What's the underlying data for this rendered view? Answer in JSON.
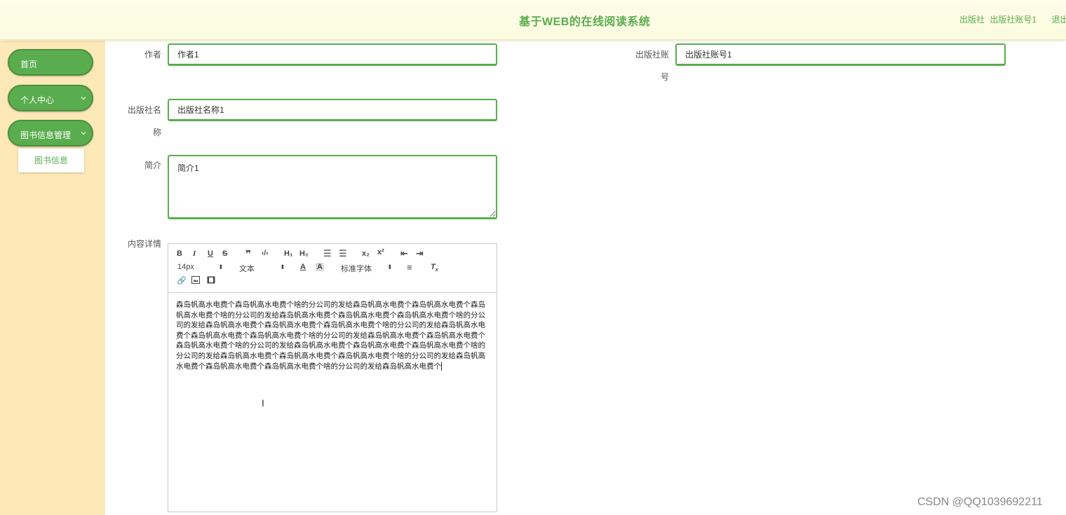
{
  "header": {
    "title": "基于WEB的在线阅读系统",
    "role": "出版社",
    "account": "出版社账号1",
    "logout": "退出"
  },
  "sidebar": {
    "items": [
      {
        "label": "首页"
      },
      {
        "label": "个人中心"
      },
      {
        "label": "图书信息管理"
      }
    ],
    "submenu_item": "图书信息"
  },
  "form": {
    "author": {
      "label": "作者",
      "value": "作者1"
    },
    "publisher_account": {
      "label_line1": "出版社账",
      "label_line2": "号",
      "value": "出版社账号1"
    },
    "publisher_name": {
      "label_line1": "出版社名",
      "label_line2": "称",
      "value": "出版社名称1"
    },
    "intro": {
      "label": "简介",
      "value": "简介1"
    },
    "content": {
      "label": "内容详情",
      "toolbar": {
        "font_size": "14px",
        "block_type": "文本",
        "font_family": "标准字体"
      },
      "text": "森岛帆高水电费个森岛帆高水电费个啥的分公司的发给森岛帆高水电费个森岛帆高水电费个森岛帆高水电费个啥的分公司的发给森岛帆高水电费个森岛帆高水电费个森岛帆高水电费个啥的分公司的发给森岛帆高水电费个森岛帆高水电费个森岛帆高水电费个啥的分公司的发给森岛帆高水电费个森岛帆高水电费个森岛帆高水电费个啥的分公司的发给森岛帆高水电费个森岛帆高水电费个森岛帆高水电费个啥的分公司的发给森岛帆高水电费个森岛帆高水电费个森岛帆高水电费个啥的分公司的发给森岛帆高水电费个森岛帆高水电费个森岛帆高水电费个啥的分公司的发给森岛帆高水电费个森岛帆高水电费个森岛帆高水电费个啥的分公司的发给森岛帆高水电费个"
    }
  },
  "watermark": "CSDN @QQ1039692211",
  "colors": {
    "accent": "#5aad4e",
    "sidebar_bg": "#fde8b8",
    "header_bg": "#fbfbe0"
  }
}
